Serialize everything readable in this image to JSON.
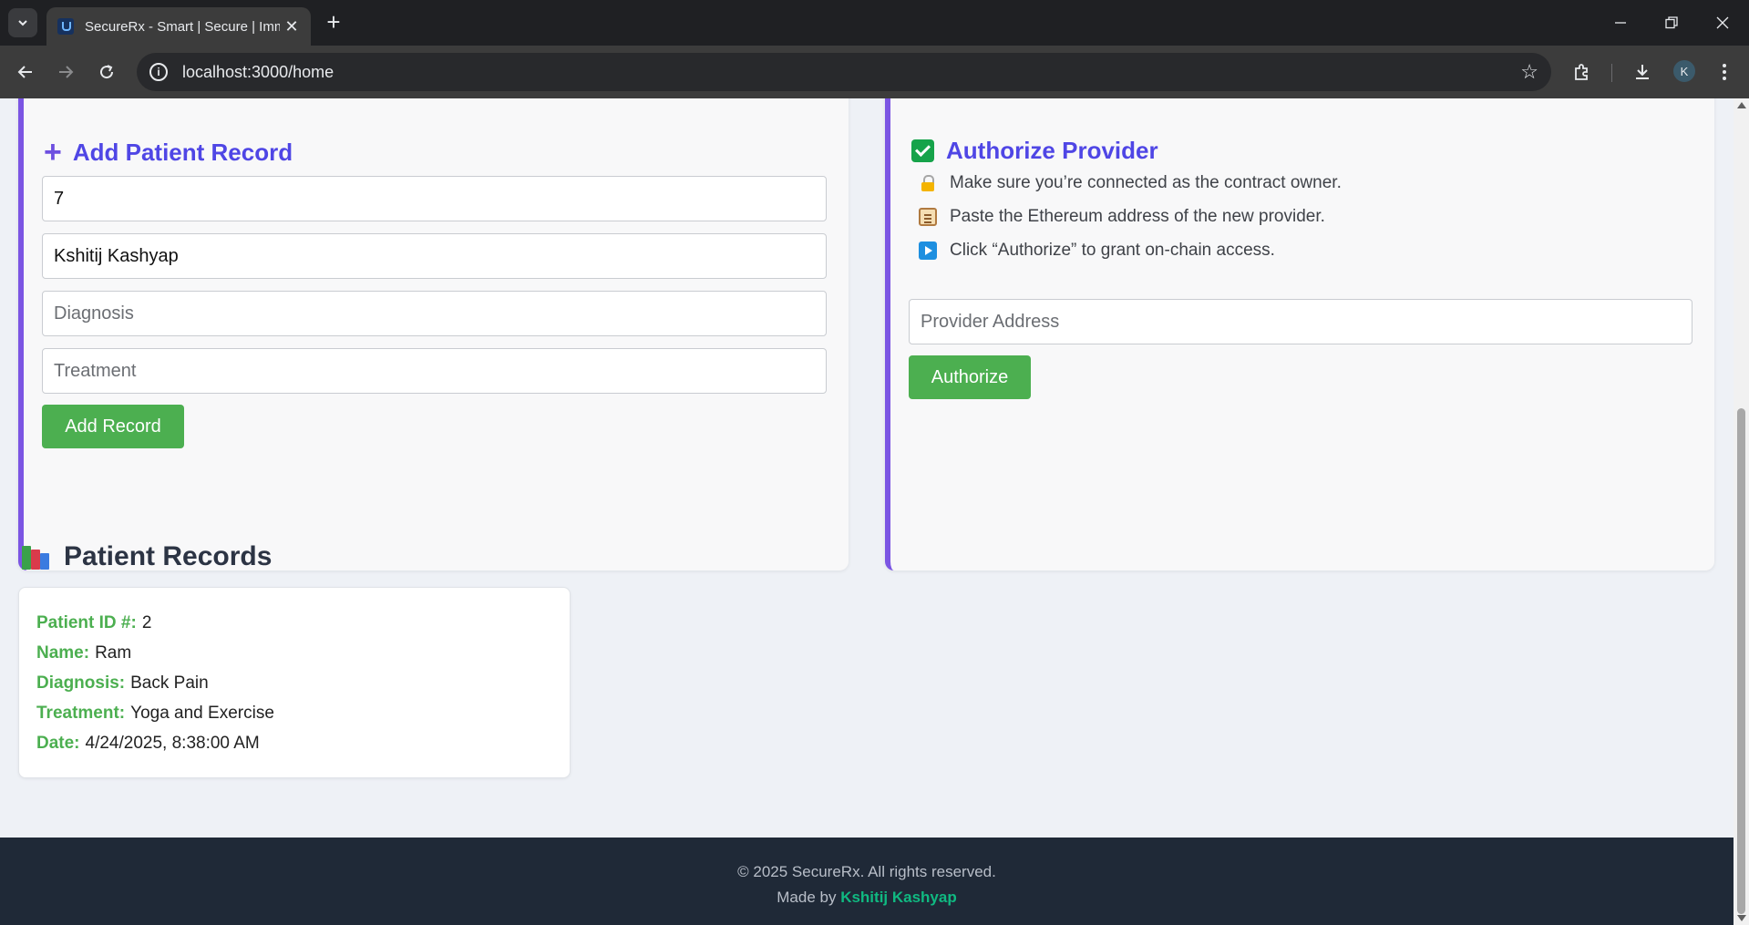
{
  "browser": {
    "tab_title": "SecureRx - Smart | Secure | Imm",
    "url": "localhost:3000/home",
    "profile_initial": "K"
  },
  "add_record": {
    "title": "Add Patient Record",
    "patient_id_value": "7",
    "name_value": "Kshitij Kashyap",
    "diagnosis_placeholder": "Diagnosis",
    "treatment_placeholder": "Treatment",
    "button_label": "Add Record"
  },
  "authorize": {
    "title": "Authorize Provider",
    "steps": [
      "Make sure you’re connected as the contract owner.",
      "Paste the Ethereum address of the new provider.",
      "Click “Authorize” to grant on-chain access."
    ],
    "address_placeholder": "Provider Address",
    "button_label": "Authorize"
  },
  "records": {
    "title": "Patient Records",
    "items": [
      {
        "id_label": "Patient ID #:",
        "id": "2",
        "name_label": "Name:",
        "name": "Ram",
        "diagnosis_label": "Diagnosis:",
        "diagnosis": "Back Pain",
        "treatment_label": "Treatment:",
        "treatment": "Yoga and Exercise",
        "date_label": "Date:",
        "date": "4/24/2025, 8:38:00 AM"
      }
    ]
  },
  "footer": {
    "copyright": "© 2025 SecureRx. All rights reserved.",
    "made_by": "Made by",
    "author": "Kshitij Kashyap"
  },
  "colors": {
    "accent_purple": "#4f46e5",
    "card_border": "#7b55e3",
    "button_green": "#4caf50",
    "footer_bg": "#1f2937",
    "author_link": "#10b981"
  }
}
